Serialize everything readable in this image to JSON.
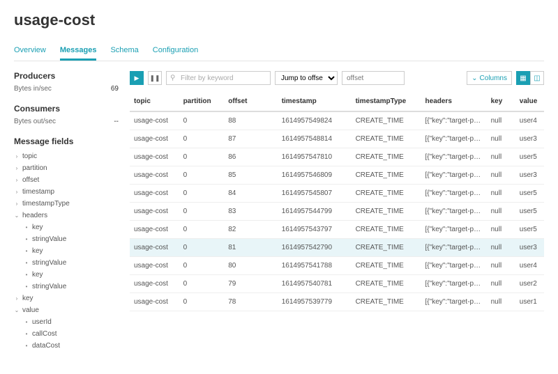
{
  "title": "usage-cost",
  "tabs": [
    "Overview",
    "Messages",
    "Schema",
    "Configuration"
  ],
  "activeTab": 1,
  "sidebar": {
    "producers": {
      "heading": "Producers",
      "label": "Bytes in/sec",
      "value": "69"
    },
    "consumers": {
      "heading": "Consumers",
      "label": "Bytes out/sec",
      "value": "--"
    },
    "messageFieldsHeading": "Message fields",
    "tree": [
      {
        "caret": "›",
        "label": "topic",
        "indent": 0
      },
      {
        "caret": "›",
        "label": "partition",
        "indent": 0
      },
      {
        "caret": "›",
        "label": "offset",
        "indent": 0
      },
      {
        "caret": "›",
        "label": "timestamp",
        "indent": 0
      },
      {
        "caret": "›",
        "label": "timestampType",
        "indent": 0
      },
      {
        "caret": "⌄",
        "label": "headers",
        "indent": 0
      },
      {
        "caret": "•",
        "label": "key",
        "indent": 1
      },
      {
        "caret": "•",
        "label": "stringValue",
        "indent": 1
      },
      {
        "caret": "•",
        "label": "key",
        "indent": 1
      },
      {
        "caret": "•",
        "label": "stringValue",
        "indent": 1
      },
      {
        "caret": "•",
        "label": "key",
        "indent": 1
      },
      {
        "caret": "•",
        "label": "stringValue",
        "indent": 1
      },
      {
        "caret": "›",
        "label": "key",
        "indent": 0
      },
      {
        "caret": "⌄",
        "label": "value",
        "indent": 0
      },
      {
        "caret": "•",
        "label": "userId",
        "indent": 1
      },
      {
        "caret": "•",
        "label": "callCost",
        "indent": 1
      },
      {
        "caret": "•",
        "label": "dataCost",
        "indent": 1
      }
    ]
  },
  "toolbar": {
    "searchPlaceholder": "Filter by keyword",
    "jumpLabel": "Jump to offset",
    "offsetPlaceholder": "offset",
    "columnsLabel": "Columns"
  },
  "columns": [
    "topic",
    "partition",
    "offset",
    "timestamp",
    "timestampType",
    "headers",
    "key",
    "value"
  ],
  "rows": [
    {
      "topic": "usage-cost",
      "partition": "0",
      "offset": "88",
      "timestamp": "1614957549824",
      "timestampType": "CREATE_TIME",
      "headers": "[{\"key\":\"target-p…",
      "key": "null",
      "value": "user4",
      "hl": false
    },
    {
      "topic": "usage-cost",
      "partition": "0",
      "offset": "87",
      "timestamp": "1614957548814",
      "timestampType": "CREATE_TIME",
      "headers": "[{\"key\":\"target-p…",
      "key": "null",
      "value": "user3",
      "hl": false
    },
    {
      "topic": "usage-cost",
      "partition": "0",
      "offset": "86",
      "timestamp": "1614957547810",
      "timestampType": "CREATE_TIME",
      "headers": "[{\"key\":\"target-p…",
      "key": "null",
      "value": "user5",
      "hl": false
    },
    {
      "topic": "usage-cost",
      "partition": "0",
      "offset": "85",
      "timestamp": "1614957546809",
      "timestampType": "CREATE_TIME",
      "headers": "[{\"key\":\"target-p…",
      "key": "null",
      "value": "user3",
      "hl": false
    },
    {
      "topic": "usage-cost",
      "partition": "0",
      "offset": "84",
      "timestamp": "1614957545807",
      "timestampType": "CREATE_TIME",
      "headers": "[{\"key\":\"target-p…",
      "key": "null",
      "value": "user5",
      "hl": false
    },
    {
      "topic": "usage-cost",
      "partition": "0",
      "offset": "83",
      "timestamp": "1614957544799",
      "timestampType": "CREATE_TIME",
      "headers": "[{\"key\":\"target-p…",
      "key": "null",
      "value": "user5",
      "hl": false
    },
    {
      "topic": "usage-cost",
      "partition": "0",
      "offset": "82",
      "timestamp": "1614957543797",
      "timestampType": "CREATE_TIME",
      "headers": "[{\"key\":\"target-p…",
      "key": "null",
      "value": "user5",
      "hl": false
    },
    {
      "topic": "usage-cost",
      "partition": "0",
      "offset": "81",
      "timestamp": "1614957542790",
      "timestampType": "CREATE_TIME",
      "headers": "[{\"key\":\"target-p…",
      "key": "null",
      "value": "user3",
      "hl": true
    },
    {
      "topic": "usage-cost",
      "partition": "0",
      "offset": "80",
      "timestamp": "1614957541788",
      "timestampType": "CREATE_TIME",
      "headers": "[{\"key\":\"target-p…",
      "key": "null",
      "value": "user4",
      "hl": false
    },
    {
      "topic": "usage-cost",
      "partition": "0",
      "offset": "79",
      "timestamp": "1614957540781",
      "timestampType": "CREATE_TIME",
      "headers": "[{\"key\":\"target-p…",
      "key": "null",
      "value": "user2",
      "hl": false
    },
    {
      "topic": "usage-cost",
      "partition": "0",
      "offset": "78",
      "timestamp": "1614957539779",
      "timestampType": "CREATE_TIME",
      "headers": "[{\"key\":\"target-p…",
      "key": "null",
      "value": "user1",
      "hl": false
    }
  ]
}
